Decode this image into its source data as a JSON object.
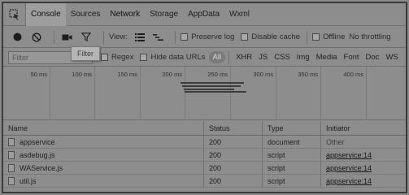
{
  "tabs": [
    {
      "label": "Console"
    },
    {
      "label": "Sources"
    },
    {
      "label": "Network"
    },
    {
      "label": "Storage"
    },
    {
      "label": "AppData"
    },
    {
      "label": "Wxml"
    }
  ],
  "toolbar": {
    "view_label": "View:",
    "preserve_log": "Preserve log",
    "disable_cache": "Disable cache",
    "offline": "Offline",
    "throttling": "No throttling"
  },
  "filterbar": {
    "placeholder": "Filter",
    "tooltip": "Filter",
    "regex": "Regex",
    "hide_data_urls": "Hide data URLs",
    "types": [
      "All",
      "XHR",
      "JS",
      "CSS",
      "Img",
      "Media",
      "Font",
      "Doc",
      "WS"
    ]
  },
  "overview": {
    "ticks": [
      "50 ms",
      "100 ms",
      "150 ms",
      "200 ms",
      "250 ms",
      "300 ms",
      "350 ms",
      "400 ms"
    ]
  },
  "table": {
    "headers": {
      "name": "Name",
      "status": "Status",
      "type": "Type",
      "initiator": "Initiator"
    },
    "rows": [
      {
        "name": "appservice",
        "status": "200",
        "type": "document",
        "initiator": "Other"
      },
      {
        "name": "asdebug.js",
        "status": "200",
        "type": "script",
        "initiator": "appservice:14"
      },
      {
        "name": "WAService.js",
        "status": "200",
        "type": "script",
        "initiator": "appservice:14"
      },
      {
        "name": "util.js",
        "status": "200",
        "type": "script",
        "initiator": "appservice:14"
      }
    ]
  }
}
